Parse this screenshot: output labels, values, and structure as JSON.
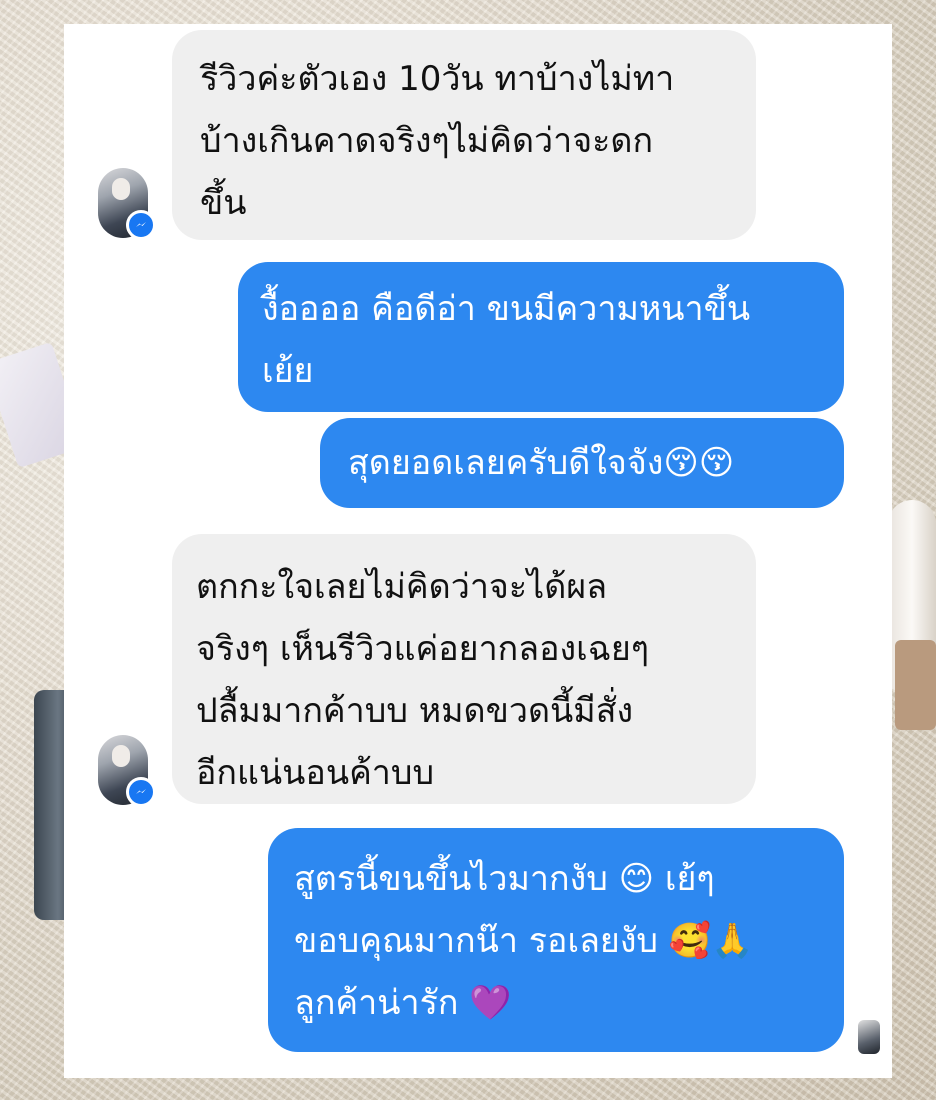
{
  "messages": [
    {
      "id": "m1",
      "side": "received",
      "text": "รีวิวค่ะตัวเอง 10วัน ทาบ้างไม่ทา\nบ้างเกินคาดจริงๆไม่คิดว่าจะดก\nขึ้น"
    },
    {
      "id": "m2",
      "side": "sent",
      "text": "งื้ออออ คือดีอ่า ขนมีความหนาขึ้น\nเย้ย"
    },
    {
      "id": "m3",
      "side": "sent",
      "text": "สุดยอดเลยครับดีใจจัง😚😚"
    },
    {
      "id": "m4",
      "side": "received",
      "text": "ตกกะใจเลยไม่คิดว่าจะได้ผล\nจริงๆ เห็นรีวิวแค่อยากลองเฉยๆ\nปลื้มมากค้าบบ หมดขวดนี้มีสั่ง\nอีกแน่นอนค้าบบ"
    },
    {
      "id": "m5",
      "side": "sent",
      "text": "สูตรนี้ขนขึ้นไวมากงับ 😊 เย้ๆ\nขอบคุณมากน๊า รอเลยงับ 🥰🙏\nลูกค้าน่ารัก 💜"
    }
  ],
  "colors": {
    "sent_bubble": "#2d88f0",
    "received_bubble": "#efefef",
    "messenger_badge": "#1877f2"
  },
  "icons": {
    "avatar": "user-avatar-photo",
    "badge": "messenger-icon"
  }
}
